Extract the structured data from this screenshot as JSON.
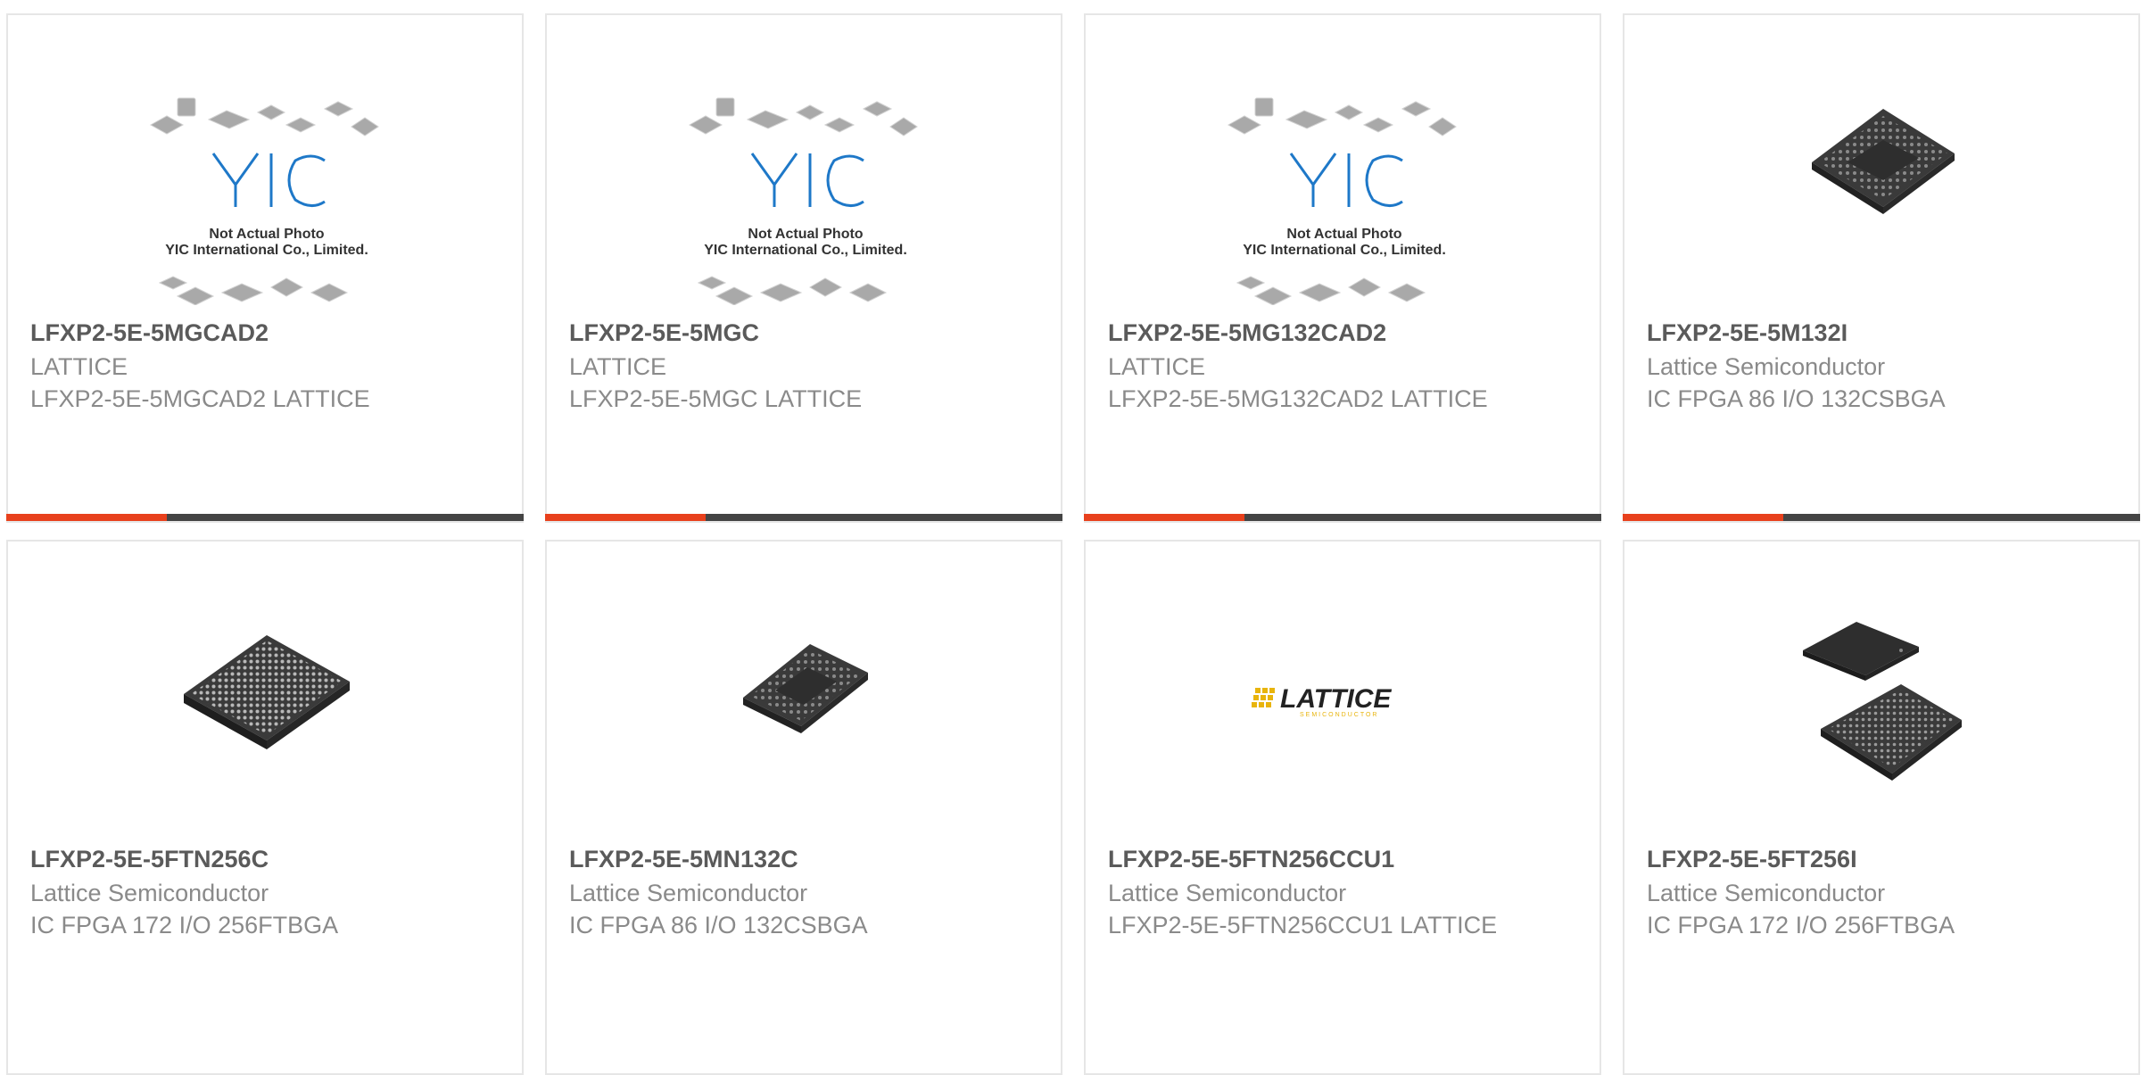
{
  "colors": {
    "accent": "#e8401c",
    "bar_track": "#444444",
    "card_border": "#e6e6e6",
    "name_text": "#5a5a5a",
    "meta_text": "#8a8a8a",
    "yic_blue": "#1e78c8",
    "lattice_yellow": "#e8b40c"
  },
  "placeholder_image": {
    "brand": "YIC",
    "caption_line1": "Not Actual Photo",
    "caption_line2": "YIC International Co., Limited."
  },
  "lattice_logo": {
    "wordmark": "LATTICE",
    "tagline": "SEMICONDUCTOR"
  },
  "products": [
    {
      "name": "LFXP2-5E-5MGCAD2",
      "manufacturer": "LATTICE",
      "description": "LFXP2-5E-5MGCAD2 LATTICE",
      "image": "yic-placeholder",
      "hover_progress": 0.31
    },
    {
      "name": "LFXP2-5E-5MGC",
      "manufacturer": "LATTICE",
      "description": "LFXP2-5E-5MGC LATTICE",
      "image": "yic-placeholder",
      "hover_progress": 0.31
    },
    {
      "name": "LFXP2-5E-5MG132CAD2",
      "manufacturer": "LATTICE",
      "description": "LFXP2-5E-5MG132CAD2 LATTICE",
      "image": "yic-placeholder",
      "hover_progress": 0.31
    },
    {
      "name": "LFXP2-5E-5M132I",
      "manufacturer": "Lattice Semiconductor",
      "description": "IC FPGA 86 I/O 132CSBGA",
      "image": "bga-chip-small",
      "hover_progress": 0.31
    },
    {
      "name": "LFXP2-5E-5FTN256C",
      "manufacturer": "Lattice Semiconductor",
      "description": "IC FPGA 172 I/O 256FTBGA",
      "image": "bga-chip-large"
    },
    {
      "name": "LFXP2-5E-5MN132C",
      "manufacturer": "Lattice Semiconductor",
      "description": "IC FPGA 86 I/O 132CSBGA",
      "image": "bga-chip-small"
    },
    {
      "name": "LFXP2-5E-5FTN256CCU1",
      "manufacturer": "Lattice Semiconductor",
      "description": "LFXP2-5E-5FTN256CCU1 LATTICE",
      "image": "lattice-logo"
    },
    {
      "name": "LFXP2-5E-5FT256I",
      "manufacturer": "Lattice Semiconductor",
      "description": "IC FPGA 172 I/O 256FTBGA",
      "image": "bga-chip-pair"
    }
  ]
}
